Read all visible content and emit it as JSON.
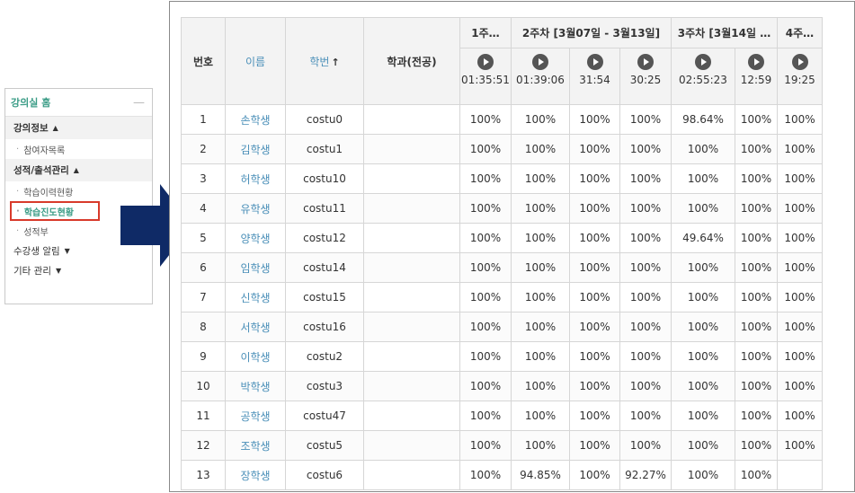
{
  "sidebar": {
    "home": "강의실 홈",
    "collapse": "—",
    "sections": [
      {
        "title": "강의정보",
        "caret": "▲",
        "items": [
          "참여자목록"
        ]
      },
      {
        "title": "성적/출석관리",
        "caret": "▲",
        "items": [
          "학습이력현황",
          "학습진도현황",
          "성적부"
        ]
      }
    ],
    "extra": [
      {
        "title": "수강생 알림",
        "caret": "▼"
      },
      {
        "title": "기타 관리",
        "caret": "▼"
      }
    ],
    "active_item": "학습진도현황"
  },
  "table": {
    "headers": {
      "number": "번호",
      "name": "이름",
      "student_id": "학번",
      "sort_arrow": "↑",
      "department": "학과(전공)",
      "weeks": [
        "1주…",
        "2주차 [3월07일 - 3월13일]",
        "3주차 [3월14일 …",
        "4주…"
      ]
    },
    "durations": [
      "01:35:51",
      "01:39:06",
      "31:54",
      "30:25",
      "02:55:23",
      "12:59",
      "19:25"
    ],
    "rows": [
      {
        "no": "1",
        "name": "손학생",
        "id": "costu0",
        "dept": "",
        "p": [
          "100%",
          "100%",
          "100%",
          "100%",
          "98.64%",
          "100%",
          "100%"
        ]
      },
      {
        "no": "2",
        "name": "김학생",
        "id": "costu1",
        "dept": "",
        "p": [
          "100%",
          "100%",
          "100%",
          "100%",
          "100%",
          "100%",
          "100%"
        ]
      },
      {
        "no": "3",
        "name": "허학생",
        "id": "costu10",
        "dept": "",
        "p": [
          "100%",
          "100%",
          "100%",
          "100%",
          "100%",
          "100%",
          "100%"
        ]
      },
      {
        "no": "4",
        "name": "유학생",
        "id": "costu11",
        "dept": "",
        "p": [
          "100%",
          "100%",
          "100%",
          "100%",
          "100%",
          "100%",
          "100%"
        ]
      },
      {
        "no": "5",
        "name": "양학생",
        "id": "costu12",
        "dept": "",
        "p": [
          "100%",
          "100%",
          "100%",
          "100%",
          "49.64%",
          "100%",
          "100%"
        ]
      },
      {
        "no": "6",
        "name": "임학생",
        "id": "costu14",
        "dept": "",
        "p": [
          "100%",
          "100%",
          "100%",
          "100%",
          "100%",
          "100%",
          "100%"
        ]
      },
      {
        "no": "7",
        "name": "신학생",
        "id": "costu15",
        "dept": "",
        "p": [
          "100%",
          "100%",
          "100%",
          "100%",
          "100%",
          "100%",
          "100%"
        ]
      },
      {
        "no": "8",
        "name": "서학생",
        "id": "costu16",
        "dept": "",
        "p": [
          "100%",
          "100%",
          "100%",
          "100%",
          "100%",
          "100%",
          "100%"
        ]
      },
      {
        "no": "9",
        "name": "이학생",
        "id": "costu2",
        "dept": "",
        "p": [
          "100%",
          "100%",
          "100%",
          "100%",
          "100%",
          "100%",
          "100%"
        ]
      },
      {
        "no": "10",
        "name": "박학생",
        "id": "costu3",
        "dept": "",
        "p": [
          "100%",
          "100%",
          "100%",
          "100%",
          "100%",
          "100%",
          "100%"
        ]
      },
      {
        "no": "11",
        "name": "공학생",
        "id": "costu47",
        "dept": "",
        "p": [
          "100%",
          "100%",
          "100%",
          "100%",
          "100%",
          "100%",
          "100%"
        ]
      },
      {
        "no": "12",
        "name": "조학생",
        "id": "costu5",
        "dept": "",
        "p": [
          "100%",
          "100%",
          "100%",
          "100%",
          "100%",
          "100%",
          "100%"
        ]
      },
      {
        "no": "13",
        "name": "장학생",
        "id": "costu6",
        "dept": "",
        "p": [
          "100%",
          "94.85%",
          "100%",
          "92.27%",
          "100%",
          "100%",
          ""
        ]
      }
    ]
  },
  "colors": {
    "accent": "#3a9c86",
    "link": "#4a8fb8",
    "highlight": "#d83a2b",
    "arrow": "#0f2a66"
  }
}
